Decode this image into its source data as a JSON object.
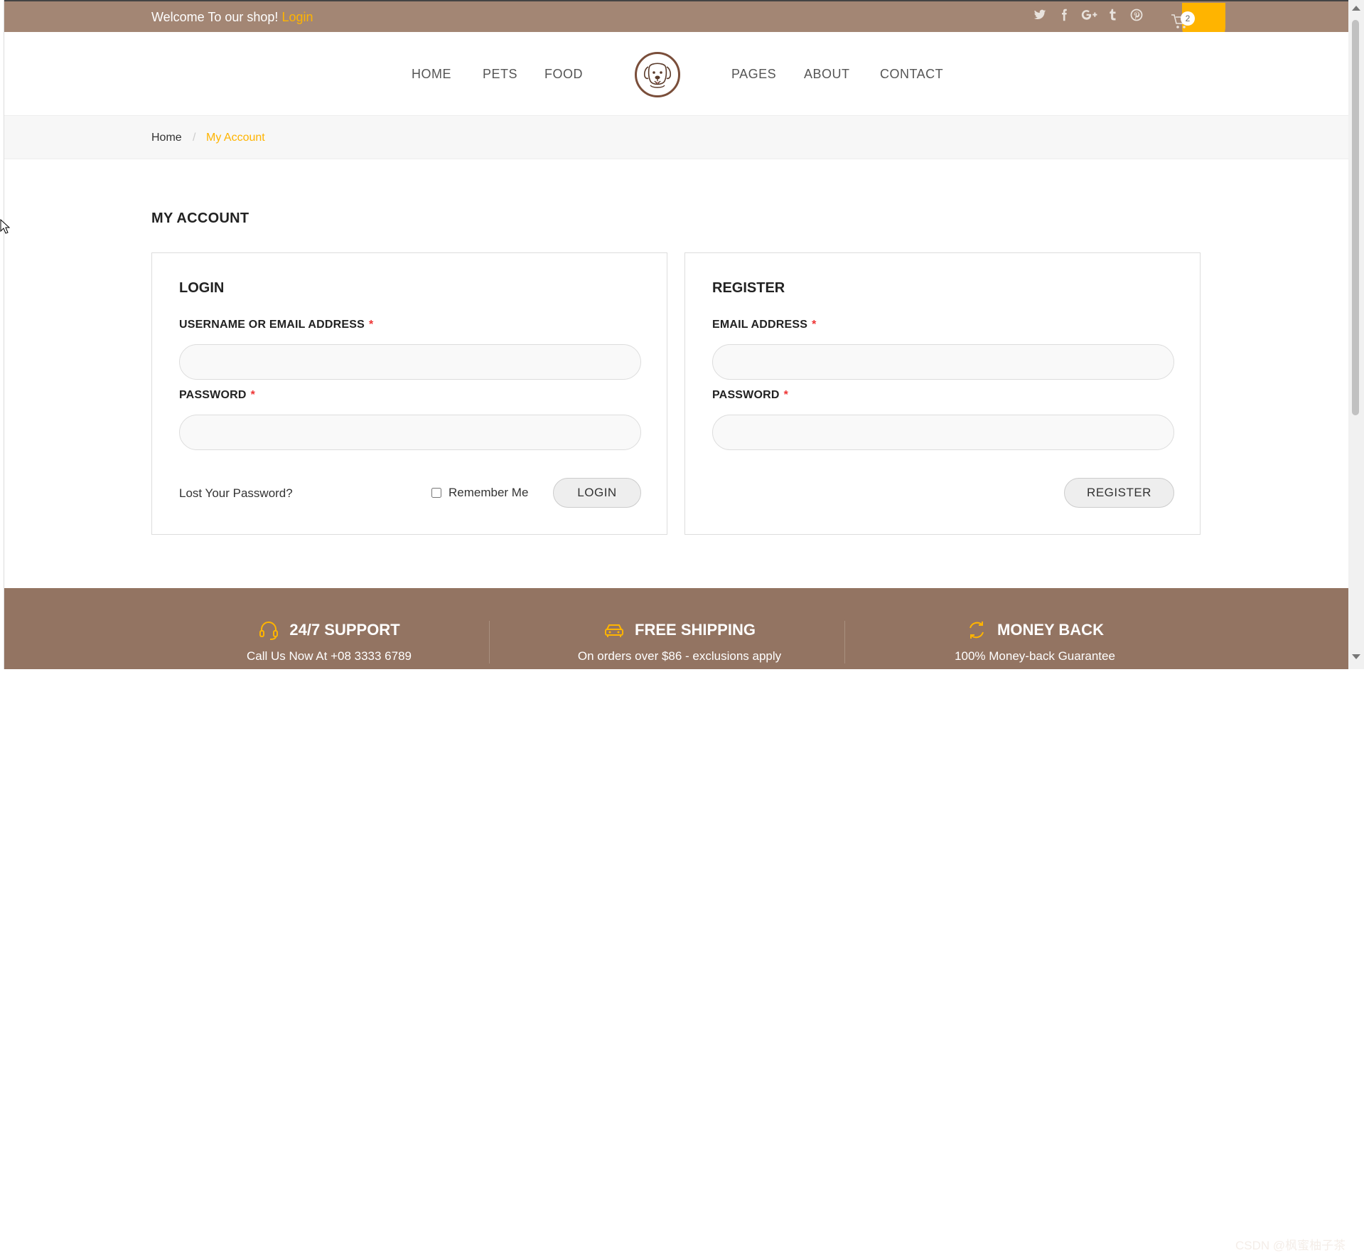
{
  "topbar": {
    "welcome_text": "Welcome To our shop! ",
    "login_link": "Login",
    "social_icons": [
      "twitter-icon",
      "facebook-icon",
      "google-plus-icon",
      "tumblr-icon",
      "pinterest-icon"
    ],
    "cart_count": "2"
  },
  "nav": {
    "items_left": [
      "HOME",
      "PETS",
      "FOOD"
    ],
    "items_right": [
      "PAGES",
      "ABOUT",
      "CONTACT"
    ]
  },
  "breadcrumb": {
    "home": "Home",
    "separator": "/",
    "current": "My Account"
  },
  "main": {
    "title": "MY ACCOUNT",
    "login": {
      "heading": "LOGIN",
      "username_label": "USERNAME OR EMAIL ADDRESS",
      "username_value": "",
      "password_label": "PASSWORD",
      "password_value": "",
      "lost_password": "Lost Your Password?",
      "remember_me": "Remember Me",
      "submit": "LOGIN"
    },
    "register": {
      "heading": "REGISTER",
      "email_label": "EMAIL ADDRESS",
      "email_value": "",
      "password_label": "PASSWORD",
      "password_value": "",
      "submit": "REGISTER"
    },
    "required_mark": "*"
  },
  "features": [
    {
      "icon": "headset-icon",
      "title": "24/7 SUPPORT",
      "desc": "Call Us Now At +08 3333 6789"
    },
    {
      "icon": "car-icon",
      "title": "FREE SHIPPING",
      "desc": "On orders over $86 - exclusions apply"
    },
    {
      "icon": "refresh-icon",
      "title": "MONEY BACK",
      "desc": "100% Money-back Guarantee"
    }
  ],
  "watermark": "CSDN @枫蜜柚子茶",
  "colors": {
    "topbar": "#a38674",
    "accent": "#ffb400",
    "footer": "#937462"
  }
}
